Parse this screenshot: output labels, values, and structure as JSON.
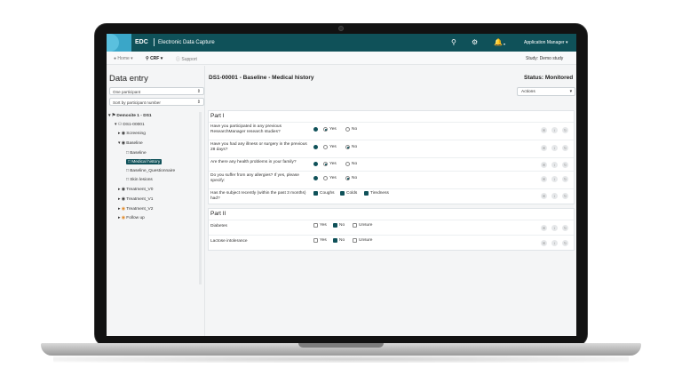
{
  "app": {
    "brand": "EDC",
    "subtitle": "Electronic Data Capture",
    "user": "Application Manager",
    "study": "Study: Demo study"
  },
  "nav": {
    "home": "Home",
    "crf": "CRF",
    "support": "Support"
  },
  "sidebar": {
    "title": "Data entry",
    "participant_select": "One participant",
    "sort_select": "Sort by participant number",
    "tree": [
      {
        "label": "Demosite 1 - DS1"
      },
      {
        "label": "DS1-00001"
      },
      {
        "label": "Screening"
      },
      {
        "label": "Baseline"
      },
      {
        "label": "Baseline"
      },
      {
        "label": "Medical history"
      },
      {
        "label": "Baseline_Questionnaire"
      },
      {
        "label": "Skin lesions"
      },
      {
        "label": "Treatment_V0"
      },
      {
        "label": "Treatment_V1"
      },
      {
        "label": "Treatment_V2"
      },
      {
        "label": "Follow up"
      }
    ]
  },
  "main": {
    "title": "DS1-00001 - Baseline - Medical history",
    "status": "Status: Monitored",
    "actions": "Actions",
    "part1": {
      "title": "Part I",
      "questions": [
        {
          "label": "Have you participated in any previous ResearchManager research studies?",
          "opt1": "Yes",
          "opt2": "No"
        },
        {
          "label": "Have you had any illness or surgery in the previous 28 days?",
          "opt1": "Yes",
          "opt2": "No"
        },
        {
          "label": "Are there any health problems in your family?",
          "opt1": "Yes",
          "opt2": "No"
        },
        {
          "label": "Do you suffer from any allergies? If yes, please specify:",
          "opt1": "Yes",
          "opt2": "No"
        },
        {
          "label": "Has the subject recently (within the past 3 months) had?",
          "opt1": "Coughs",
          "opt2": "Colds",
          "opt3": "Tiredness"
        }
      ]
    },
    "part2": {
      "title": "Part II",
      "questions": [
        {
          "label": "Diabetes",
          "opt1": "Yes",
          "opt2": "No",
          "opt3": "Unsure"
        },
        {
          "label": "Lactose intolerance",
          "opt1": "Yes",
          "opt2": "No",
          "opt3": "Unsure"
        }
      ]
    }
  },
  "colors": {
    "primary": "#0f5159",
    "accent": "#3aa6c8"
  }
}
